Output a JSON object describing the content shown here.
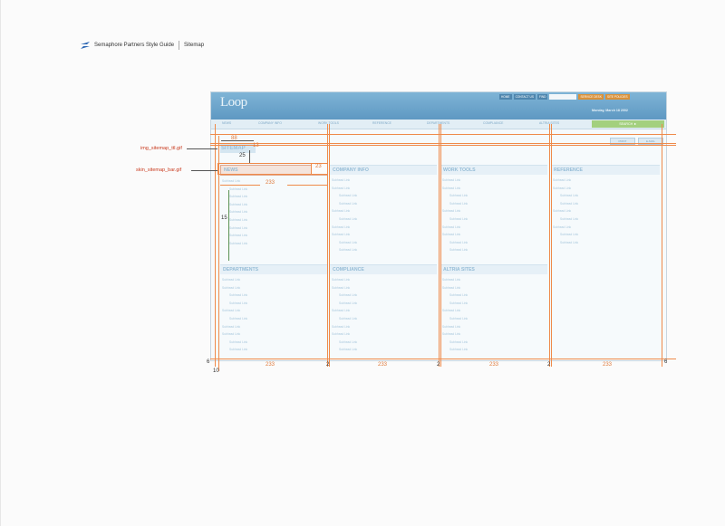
{
  "header": {
    "brand": "Semaphore Partners Style Guide",
    "page": "Sitemap"
  },
  "mockup": {
    "logo": "Loop",
    "top_links": [
      "HOME",
      "CONTACT US",
      "FIND",
      "SERVICE DESK",
      "SITE POLICIES"
    ],
    "date": "Monday, March 18 2002",
    "nav": [
      "NEWS",
      "COMPANY INFO",
      "WORK TOOLS",
      "REFERENCE",
      "DEPARTMENTS",
      "COMPLIANCE",
      "ALTRIA SITES"
    ],
    "search_label": "SEARCH",
    "page_buttons": [
      "PRINT",
      "E-MAIL"
    ],
    "sitemap_title": "SITEMAP",
    "sections": [
      {
        "heading": "NEWS",
        "items": [
          "Subhead Link",
          "Subhead Link",
          "Subhead Link",
          "Subhead Link",
          "Subhead Link",
          "Subhead Link",
          "Subhead Link",
          "Subhead Link",
          "Subhead Link",
          "Subhead Link"
        ]
      },
      {
        "heading": "COMPANY INFO",
        "items": [
          "Subhead Link",
          "Subhead Link",
          "Subhead Link",
          "Subhead Link",
          "Subhead Link",
          "Subhead Link",
          "Subhead Link",
          "Subhead Link",
          "Subhead Link",
          "Subhead Link"
        ]
      },
      {
        "heading": "WORK TOOLS",
        "items": [
          "Subhead Link",
          "Subhead Link",
          "Subhead Link",
          "Subhead Link",
          "Subhead Link",
          "Subhead Link",
          "Subhead Link",
          "Subhead Link",
          "Subhead Link",
          "Subhead Link"
        ]
      },
      {
        "heading": "REFERENCE",
        "items": [
          "Subhead Link",
          "Subhead Link",
          "Subhead Link",
          "Subhead Link",
          "Subhead Link",
          "Subhead Link",
          "Subhead Link",
          "Subhead Link",
          "Subhead Link"
        ]
      },
      {
        "heading": "DEPARTMENTS",
        "items": [
          "Subhead Link",
          "Subhead Link",
          "Subhead Link",
          "Subhead Link",
          "Subhead Link",
          "Subhead Link",
          "Subhead Link",
          "Subhead Link",
          "Subhead Link",
          "Subhead Link"
        ]
      },
      {
        "heading": "COMPLIANCE",
        "items": [
          "Subhead Link",
          "Subhead Link",
          "Subhead Link",
          "Subhead Link",
          "Subhead Link",
          "Subhead Link",
          "Subhead Link",
          "Subhead Link",
          "Subhead Link",
          "Subhead Link"
        ]
      },
      {
        "heading": "ALTRIA SITES",
        "items": [
          "Subhead Link",
          "Subhead Link",
          "Subhead Link",
          "Subhead Link",
          "Subhead Link",
          "Subhead Link",
          "Subhead Link",
          "Subhead Link",
          "Subhead Link",
          "Subhead Link"
        ]
      }
    ]
  },
  "annotations": {
    "callout_title": "img_sitemap_ttl.gif",
    "callout_bar": "skin_sitemap_bar.gif",
    "title_width": "88",
    "title_height": "13",
    "title_gap": "25",
    "bar_height": "23",
    "col_width": "233",
    "line_spacing": "15",
    "bottom": [
      "233",
      "2",
      "233",
      "2",
      "233",
      "2",
      "233"
    ],
    "margin_left": "6",
    "margin_left_inner": "10",
    "margin_right": "6"
  },
  "colors": {
    "accent": "#ef8a4a",
    "topbar": "#6aa6cf",
    "search": "#a3d07e",
    "spacing_guide": "#5a9254"
  }
}
